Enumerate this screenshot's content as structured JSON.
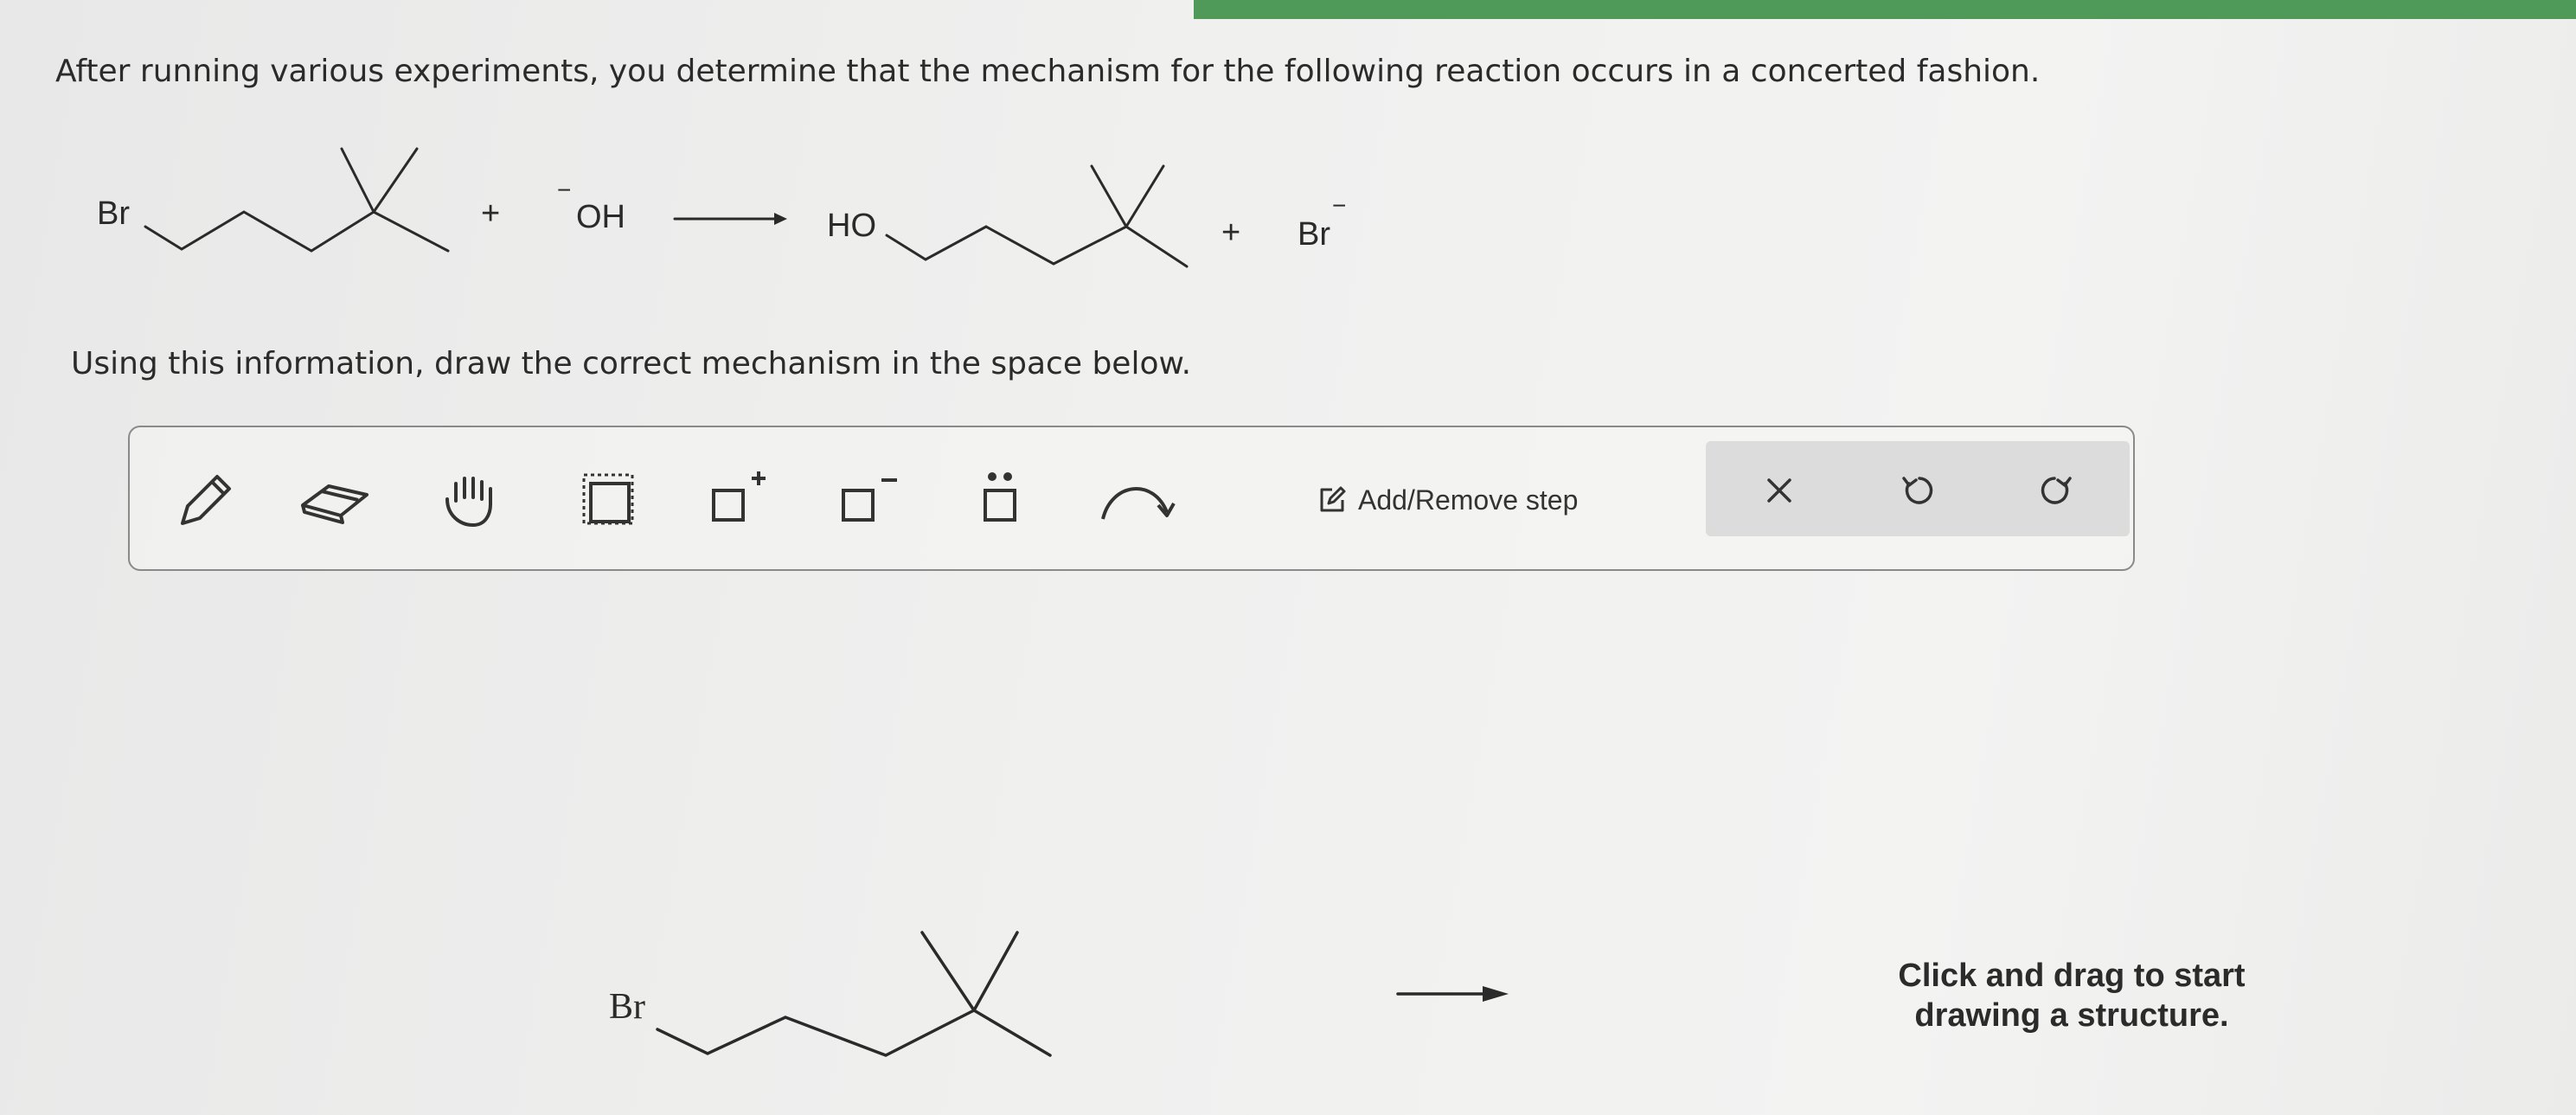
{
  "question": {
    "prompt": "After running various experiments, you determine that the mechanism for the following reaction occurs in a concerted fashion.",
    "instruction": "Using this information, draw the correct mechanism in the space below."
  },
  "reaction": {
    "reactant_label": "Br",
    "plus_1": "+",
    "nucleophile_label": "OH",
    "nucleophile_charge": "−",
    "product_label": "HO",
    "plus_2": "+",
    "leaving_group_label": "Br",
    "leaving_group_charge": "−"
  },
  "toolbar": {
    "tools": [
      "pencil-icon",
      "eraser-icon",
      "hand-icon",
      "selection-icon",
      "positive-charge-icon",
      "negative-charge-icon",
      "lone-pair-icon",
      "curved-arrow-icon"
    ],
    "add_remove_step_label": "Add/Remove step",
    "actions": [
      "clear-icon",
      "undo-icon",
      "redo-icon"
    ]
  },
  "canvas": {
    "structure_label": "Br",
    "hint_line1": "Click and drag to start",
    "hint_line2": "drawing a structure."
  }
}
